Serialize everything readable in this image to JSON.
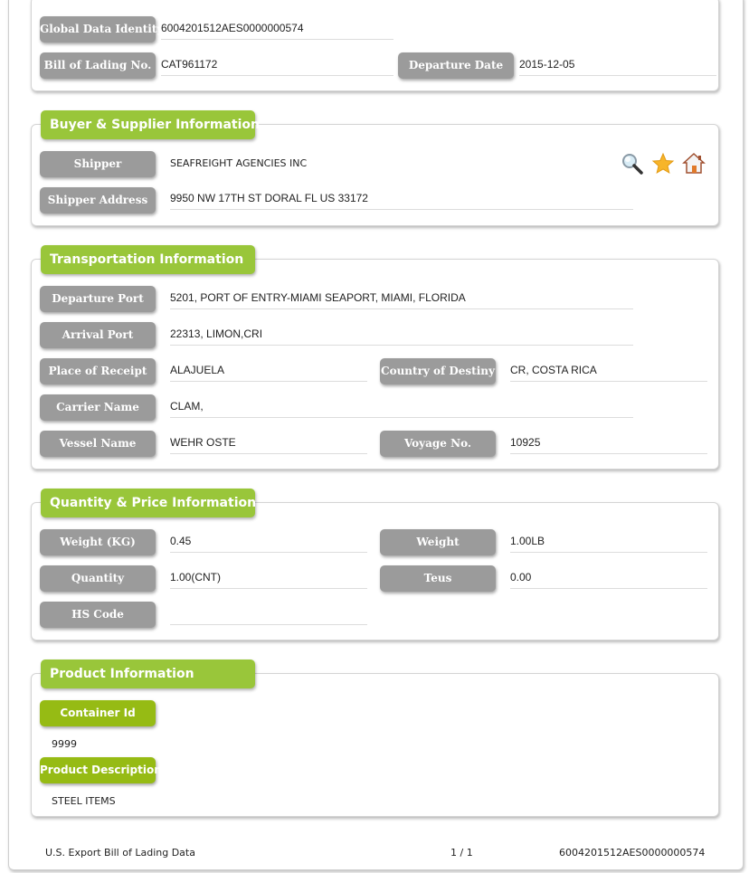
{
  "header": {
    "global_data_identity": {
      "label": "Global Data Identity",
      "value": "6004201512AES0000000574"
    },
    "bill_of_lading": {
      "label": "Bill of Lading No.",
      "value": "CAT961172"
    },
    "departure_date": {
      "label": "Departure Date",
      "value": "2015-12-05"
    }
  },
  "buyer_supplier": {
    "title": "Buyer & Supplier Information",
    "shipper": {
      "label": "Shipper",
      "value": "SEAFREIGHT AGENCIES INC"
    },
    "shipper_address": {
      "label": "Shipper Address",
      "value": "9950 NW 17TH ST DORAL FL US 33172"
    },
    "icons": [
      "search-icon",
      "star-icon",
      "home-icon"
    ]
  },
  "transportation": {
    "title": "Transportation Information",
    "departure_port": {
      "label": "Departure Port",
      "value": "5201, PORT OF ENTRY-MIAMI SEAPORT, MIAMI, FLORIDA"
    },
    "arrival_port": {
      "label": "Arrival Port",
      "value": "22313, LIMON,CRI"
    },
    "place_of_receipt": {
      "label": "Place of Receipt",
      "value": "ALAJUELA"
    },
    "country_of_destiny": {
      "label": "Country of Destiny",
      "value": "CR, COSTA RICA"
    },
    "carrier_name": {
      "label": "Carrier Name",
      "value": "CLAM,"
    },
    "vessel_name": {
      "label": "Vessel Name",
      "value": "WEHR OSTE"
    },
    "voyage_no": {
      "label": "Voyage No.",
      "value": "10925"
    }
  },
  "quantity_price": {
    "title": "Quantity & Price Information",
    "weight_kg": {
      "label": "Weight (KG)",
      "value": "0.45"
    },
    "weight": {
      "label": "Weight",
      "value": "1.00LB"
    },
    "quantity": {
      "label": "Quantity",
      "value": "1.00(CNT)"
    },
    "teus": {
      "label": "Teus",
      "value": "0.00"
    },
    "hs_code": {
      "label": "HS Code",
      "value": ""
    }
  },
  "product": {
    "title": "Product Information",
    "container_id": {
      "label": "Container Id",
      "value": "9999"
    },
    "product_description": {
      "label": "Product Description",
      "value": "STEEL ITEMS"
    }
  },
  "footer": {
    "source": "U.S. Export Bill of Lading Data",
    "page": "1 / 1",
    "identity": "6004201512AES0000000574"
  },
  "colors": {
    "section_header": "#99c63a",
    "field_label": "#9b9b9b",
    "product_label": "#96bb14"
  }
}
